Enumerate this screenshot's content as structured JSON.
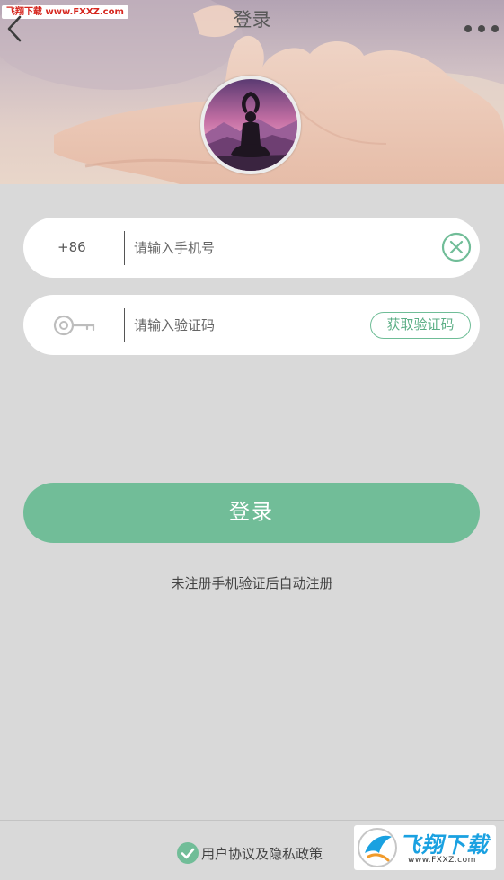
{
  "watermark_top": "飞翔下载 www.FXXZ.com",
  "header": {
    "title": "登录"
  },
  "phone": {
    "prefix": "+86",
    "placeholder": "请输入手机号",
    "value": ""
  },
  "code": {
    "placeholder": "请输入验证码",
    "value": "",
    "button_label": "获取验证码"
  },
  "login_label": "登录",
  "hint": "未注册手机验证后自动注册",
  "agreement_label": "用户协议及隐私政策",
  "watermark_bottom": {
    "brand": "飞翔下载",
    "url": "www.FXXZ.com"
  },
  "colors": {
    "accent": "#71bd98",
    "background": "#d9d9d9",
    "watermark_red": "#d6261e",
    "watermark_blue": "#1aa1e1"
  },
  "icons": [
    "back-arrow-icon",
    "more-dots-icon",
    "clear-icon",
    "key-icon",
    "check-circle-icon",
    "fxxz-logo-icon"
  ]
}
